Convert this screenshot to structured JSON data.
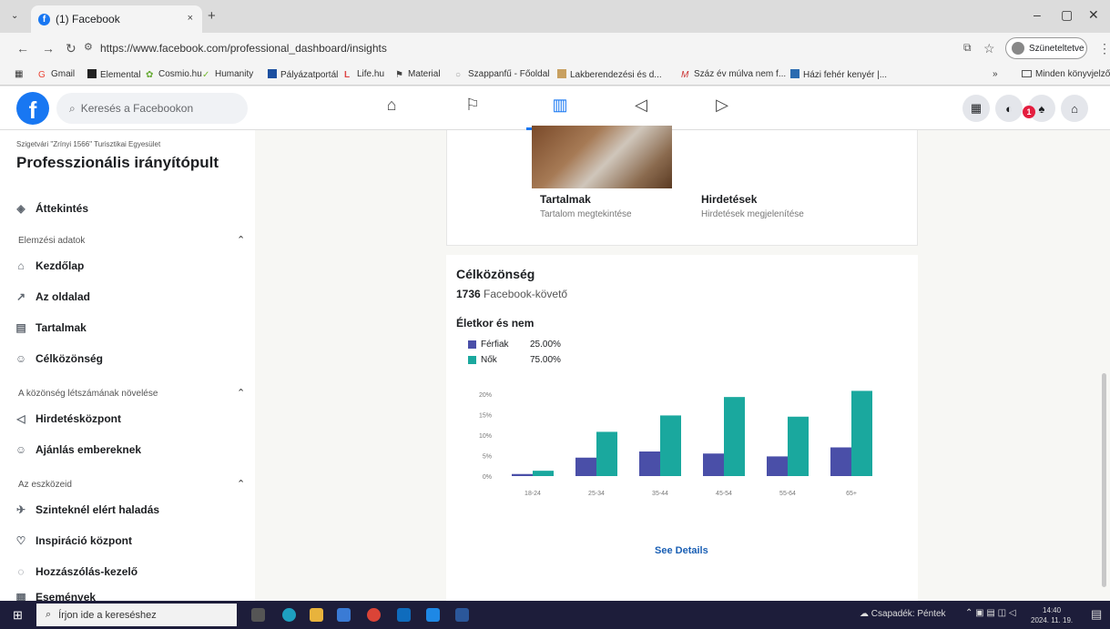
{
  "browser": {
    "tab_title": "(1) Facebook",
    "tab_close": "×",
    "new_tab": "+",
    "url": "https://www.facebook.com/professional_dashboard/insights",
    "profile_status": "Szüneteltetve",
    "bookmarks": [
      "Gmail",
      "Elemental",
      "Cosmio.hu",
      "Humanity",
      "Pályázatportál",
      "Life.hu",
      "Material",
      "Szappanfű - Főoldal",
      "Lakberendezési és d...",
      "Száz év múlva nem f...",
      "Házi fehér kenyér |..."
    ],
    "bookmarks_overflow": "»",
    "all_bookmarks": "Minden könyvjelző"
  },
  "facebook": {
    "logo": "f",
    "search_placeholder": "Keresés a Facebookon",
    "notification_count": "1"
  },
  "sidebar": {
    "page_name": "Szigetvári \"Zrínyi 1566\" Turisztikai Egyesület",
    "title": "Professzionális irányítópult",
    "overview": "Áttekintés",
    "section1": "Elemzési adatok",
    "items1": [
      "Kezdőlap",
      "Az oldalad",
      "Tartalmak",
      "Célközönség"
    ],
    "section2": "A közönség létszámának növelése",
    "items2": [
      "Hirdetésközpont",
      "Ajánlás embereknek"
    ],
    "section3": "Az eszközeid",
    "items3": [
      "Szinteknél elért haladás",
      "Inspiráció központ",
      "Hozzászólás-kezelő",
      "Események"
    ]
  },
  "cards": {
    "content_title": "Tartalmak",
    "content_sub": "Tartalom megtekintése",
    "ads_title": "Hirdetések",
    "ads_sub": "Hirdetések megjelenítése"
  },
  "audience": {
    "title": "Célközönség",
    "count": "1736",
    "count_label": "Facebook-követő",
    "age_gender_title": "Életkor és nem",
    "legend": [
      {
        "name": "Férfiak",
        "pct": "25.00%"
      },
      {
        "name": "Nők",
        "pct": "75.00%"
      }
    ],
    "see_details": "See Details"
  },
  "chart_data": {
    "type": "bar",
    "categories": [
      "18-24",
      "25-34",
      "35-44",
      "45-54",
      "55-64",
      "65+"
    ],
    "series": [
      {
        "name": "Férfiak",
        "values": [
          0.5,
          4.5,
          6,
          5.5,
          4.8,
          7
        ],
        "color": "#4a4fa8"
      },
      {
        "name": "Nők",
        "values": [
          1.3,
          10.8,
          14.8,
          19.3,
          14.5,
          20.8
        ],
        "color": "#1aa89e"
      }
    ],
    "y_ticks": [
      "20%",
      "15%",
      "10%",
      "5%",
      "0%"
    ],
    "ylim": [
      0,
      20
    ],
    "grid": false
  },
  "taskbar": {
    "search_placeholder": "Írjon ide a kereséshez",
    "weather": "Csapadék: Péntek",
    "time": "14:40",
    "date": "2024. 11. 19."
  },
  "colors": {
    "facebook_blue": "#1877f2",
    "male": "#4a4fa8",
    "female": "#1aa89e"
  }
}
